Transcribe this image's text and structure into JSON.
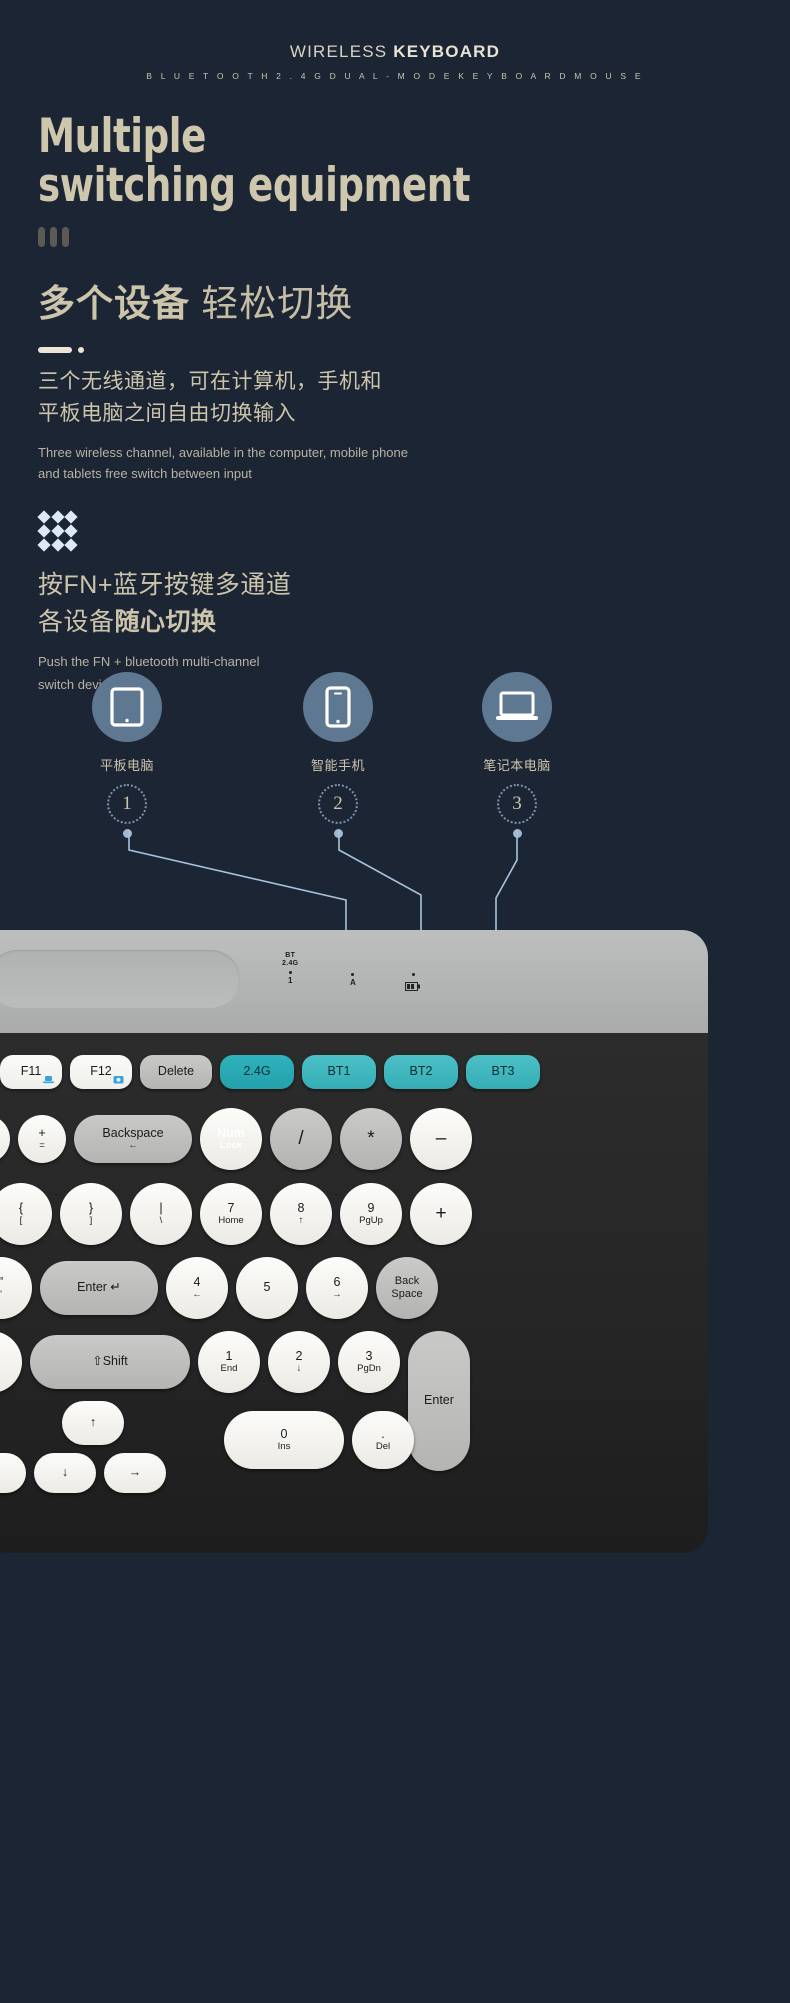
{
  "header": {
    "title_light": "WIRELESS ",
    "title_bold": "KEYBOARD",
    "subtitle": "B L U E T O O T H   2 . 4   G   D U A L - M O D E   K E Y B O A R D   M O U S E"
  },
  "hero": {
    "line1": "Multiple",
    "line2": "switching equipment"
  },
  "section1": {
    "cn_bold": "多个设备",
    "cn_normal": " 轻松切换",
    "cn_body_line1": "三个无线通道，可在计算机，手机和",
    "cn_body_line2": "平板电脑之间自由切换输入",
    "en_line1": "Three wireless channel, available in the computer, mobile phone",
    "en_line2": "and tablets free switch between input"
  },
  "section2": {
    "cn_line1": "按FN+蓝牙按键多通道",
    "cn_line2_normal": "各设备",
    "cn_line2_bold": "随心切换",
    "en_line1": "Push the FN + bluetooth multi-channel",
    "en_line2": "switch devices do"
  },
  "devices": [
    {
      "icon": "tablet-icon",
      "label": "平板电脑",
      "number": "1"
    },
    {
      "icon": "smartphone-icon",
      "label": "智能手机",
      "number": "2"
    },
    {
      "icon": "laptop-icon",
      "label": "笔记本电脑",
      "number": "3"
    }
  ],
  "keyboard": {
    "indicators": [
      {
        "top": "BT",
        "top2": "2.4G",
        "symbol": "1"
      },
      {
        "top": "",
        "top2": "",
        "symbol": "A"
      },
      {
        "top": "",
        "top2": "",
        "symbol": "battery-icon"
      }
    ],
    "row_fn": [
      {
        "label": "F11",
        "style": "pill",
        "icon": "laptop-badge-icon"
      },
      {
        "label": "F12",
        "style": "pill",
        "icon": "screenshot-badge-icon"
      },
      {
        "label": "Delete",
        "style": "grey"
      },
      {
        "label": "2.4G",
        "style": "teal"
      },
      {
        "label": "BT1",
        "style": "teal2"
      },
      {
        "label": "BT2",
        "style": "teal2"
      },
      {
        "label": "BT3",
        "style": "teal2"
      }
    ],
    "row2": [
      {
        "main": "—",
        "sub": "",
        "style": "round"
      },
      {
        "main": "+",
        "sub": "=",
        "style": "round"
      },
      {
        "main": "Backspace",
        "sub": "←",
        "style": "grey"
      },
      {
        "main": "Num",
        "sub": "Lock",
        "style": "red"
      },
      {
        "main": "/",
        "sub": "",
        "style": "roundg"
      },
      {
        "main": "*",
        "sub": "",
        "style": "roundg"
      },
      {
        "main": "–",
        "sub": "",
        "style": "round"
      }
    ],
    "row3": [
      {
        "main": "{",
        "sub": "[",
        "style": "round"
      },
      {
        "main": "}",
        "sub": "]",
        "style": "round"
      },
      {
        "main": "|",
        "sub": "\\",
        "style": "round"
      },
      {
        "main": "7",
        "sub": "Home",
        "style": "round"
      },
      {
        "main": "8",
        "sub": "↑",
        "style": "round"
      },
      {
        "main": "9",
        "sub": "PgUp",
        "style": "round"
      },
      {
        "main": "+",
        "sub": "",
        "style": "round"
      }
    ],
    "row4": [
      {
        "main": "\"",
        "sub": "'",
        "style": "round"
      },
      {
        "main": "Enter ↵",
        "sub": "",
        "style": "grey"
      },
      {
        "main": "4",
        "sub": "←",
        "style": "round"
      },
      {
        "main": "5",
        "sub": "",
        "style": "round"
      },
      {
        "main": "6",
        "sub": "→",
        "style": "round"
      },
      {
        "main": "Back",
        "sub": "Space",
        "style": "roundg"
      }
    ],
    "row5": [
      {
        "main": "?",
        "sub": "/",
        "style": "round"
      },
      {
        "main": "⇧Shift",
        "sub": "",
        "style": "grey"
      },
      {
        "main": "1",
        "sub": "End",
        "style": "round"
      },
      {
        "main": "2",
        "sub": "↓",
        "style": "round"
      },
      {
        "main": "3",
        "sub": "PgDn",
        "style": "round"
      },
      {
        "main": "Enter",
        "sub": "",
        "style": "grey"
      }
    ],
    "row6": [
      {
        "main": "↑",
        "sub": "",
        "style": "round"
      },
      {
        "main": "0",
        "sub": "Ins",
        "style": "round"
      },
      {
        "main": ".",
        "sub": "Del",
        "style": "round"
      }
    ],
    "row7": [
      {
        "main": "←",
        "sub": "",
        "style": "round"
      },
      {
        "main": "↓",
        "sub": "",
        "style": "round"
      },
      {
        "main": "→",
        "sub": "",
        "style": "round"
      }
    ]
  },
  "colors": {
    "background": "#1b2533",
    "accent_beige": "#cdc4ac",
    "device_circle": "#5f7892",
    "connector": "#a8c4dd",
    "teal_key": "#2fb3bd",
    "red_key": "#e01f1c"
  }
}
